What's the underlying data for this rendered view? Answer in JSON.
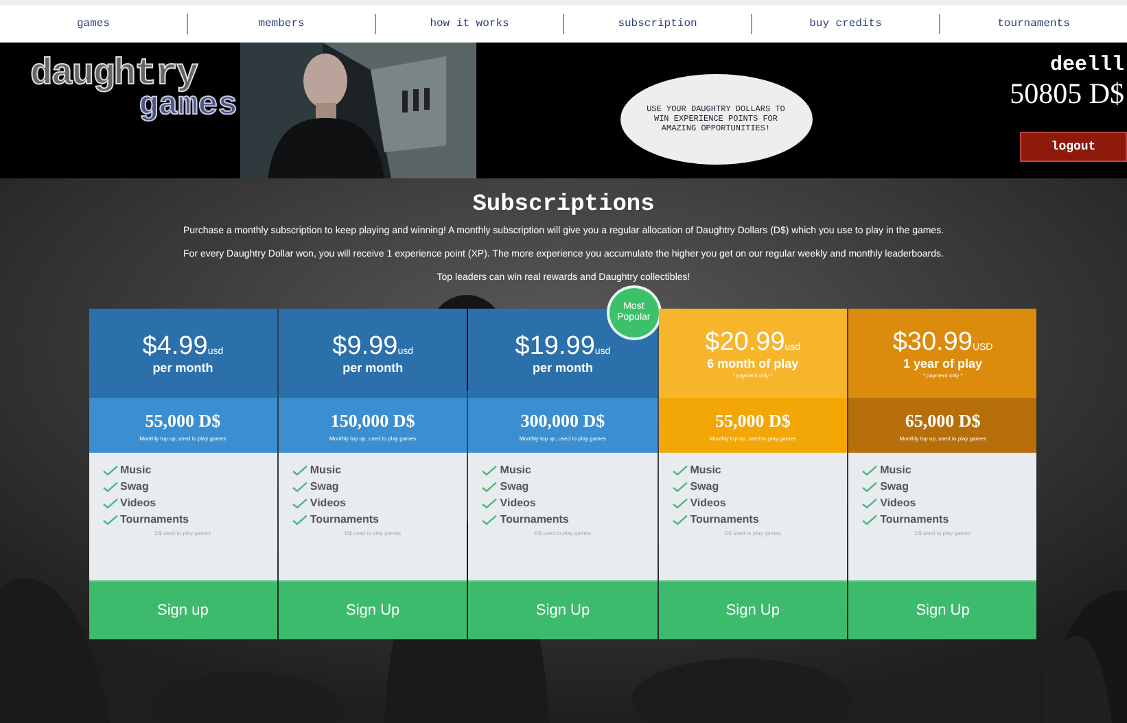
{
  "nav": [
    "games",
    "members",
    "how it works",
    "subscription",
    "buy credits",
    "tournaments"
  ],
  "header": {
    "logo_top": "daughtry",
    "logo_bottom": "games",
    "tagline": "USE YOUR DAUGHTRY DOLLARS TO WIN EXPERIENCE POINTS FOR AMAZING OPPORTUNITIES!",
    "username": "deelll",
    "balance": "50805 D$",
    "logout": "logout"
  },
  "title": "Subscriptions",
  "intro": [
    "Purchase a monthly subscription to keep playing and winning! A monthly subscription will give you a regular allocation of Daughtry Dollars (D$) which you use to play in the games.",
    "For every Daughtry Dollar won, you will receive 1 experience point (XP). The more experience you accumulate the higher you get on our regular weekly and monthly leaderboards.",
    "Top leaders can win real rewards and Daughtry collectibles!"
  ],
  "plans": [
    {
      "kind": "monthly",
      "price": "$4.99",
      "currency": "usd",
      "period": "per month",
      "credits": "55,000 D$",
      "credits_note": "Monthly top up, used to play games",
      "features": [
        "Music",
        "Swag",
        "Videos",
        "Tournaments"
      ],
      "footnote": "D$ used to play games",
      "button": "Sign up"
    },
    {
      "kind": "monthly",
      "price": "$9.99",
      "currency": "usd",
      "period": "per month",
      "credits": "150,000 D$",
      "credits_note": "Monthly top up, used to play games",
      "features": [
        "Music",
        "Swag",
        "Videos",
        "Tournaments"
      ],
      "footnote": "D$ used to play games",
      "button": "Sign Up"
    },
    {
      "kind": "monthly",
      "price": "$19.99",
      "currency": "usd",
      "period": "per month",
      "credits": "300,000 D$",
      "credits_note": "Monthly top up, used to play games",
      "features": [
        "Music",
        "Swag",
        "Videos",
        "Tournaments"
      ],
      "footnote": "D$ used to play games",
      "button": "Sign Up",
      "badge": "Most Popular"
    },
    {
      "kind": "half_year",
      "price": "$20.99",
      "currency": "usd",
      "period": "6 month of play",
      "period_note": "* payment only *",
      "credits": "55,000 D$",
      "credits_note": "Monthly top up, used to play games",
      "features": [
        "Music",
        "Swag",
        "Videos",
        "Tournaments"
      ],
      "footnote": "D$ used to play games",
      "button": "Sign Up"
    },
    {
      "kind": "year",
      "price": "$30.99",
      "currency": "USD",
      "period": "1 year of play",
      "period_note": "* payment only *",
      "credits": "65,000 D$",
      "credits_note": "Monthly top up, used to play games",
      "features": [
        "Music",
        "Swag",
        "Videos",
        "Tournaments"
      ],
      "footnote": "D$ used to play games",
      "button": "Sign Up"
    }
  ]
}
